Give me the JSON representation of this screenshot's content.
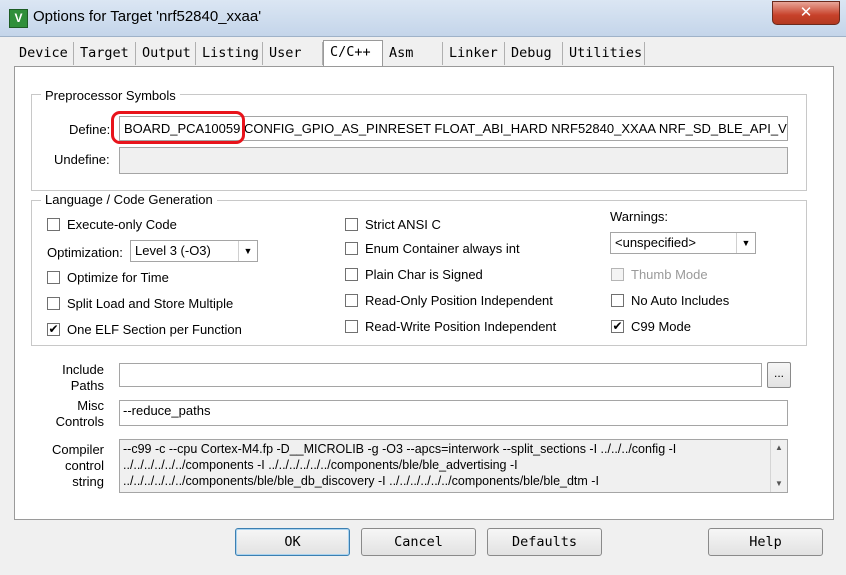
{
  "window": {
    "title": "Options for Target 'nrf52840_xxaa'",
    "app_icon": "keil-uvision-icon",
    "close_glyph": "✕"
  },
  "tabs": [
    {
      "label": "Device"
    },
    {
      "label": "Target"
    },
    {
      "label": "Output"
    },
    {
      "label": "Listing"
    },
    {
      "label": "User"
    },
    {
      "label": "C/C++",
      "active": true
    },
    {
      "label": "Asm"
    },
    {
      "label": "Linker"
    },
    {
      "label": "Debug"
    },
    {
      "label": "Utilities"
    }
  ],
  "preprocessor": {
    "legend": "Preprocessor Symbols",
    "define_label": "Define:",
    "define_value": "BOARD_PCA10059 CONFIG_GPIO_AS_PINRESET FLOAT_ABI_HARD NRF52840_XXAA NRF_SD_BLE_API_V",
    "undefine_label": "Undefine:",
    "undefine_value": ""
  },
  "language": {
    "legend": "Language / Code Generation",
    "execute_only": {
      "label": "Execute-only Code",
      "checked": false
    },
    "optimization_label": "Optimization:",
    "optimization_value": "Level 3 (-O3)",
    "optimize_time": {
      "label": "Optimize for Time",
      "checked": false
    },
    "split_load": {
      "label": "Split Load and Store Multiple",
      "checked": false
    },
    "one_elf": {
      "label": "One ELF Section per Function",
      "checked": true
    },
    "strict_ansi": {
      "label": "Strict ANSI C",
      "checked": false
    },
    "enum_container": {
      "label": "Enum Container always int",
      "checked": false
    },
    "plain_char": {
      "label": "Plain Char is Signed",
      "checked": false
    },
    "ropi": {
      "label": "Read-Only Position Independent",
      "checked": false
    },
    "rwpi": {
      "label": "Read-Write Position Independent",
      "checked": false
    },
    "warnings_label": "Warnings:",
    "warnings_value": "<unspecified>",
    "thumb_mode": {
      "label": "Thumb Mode",
      "checked": false,
      "disabled": true
    },
    "no_auto_includes": {
      "label": "No Auto Includes",
      "checked": false
    },
    "c99_mode": {
      "label": "C99 Mode",
      "checked": true
    },
    "check_glyph": "✔"
  },
  "include_paths": {
    "label_line1": "Include",
    "label_line2": "Paths",
    "value": "",
    "browse_label": "..."
  },
  "misc_controls": {
    "label_line1": "Misc",
    "label_line2": "Controls",
    "value": "--reduce_paths"
  },
  "compiler_string": {
    "label_line1": "Compiler",
    "label_line2": "control",
    "label_line3": "string",
    "lines": [
      "--c99 -c --cpu Cortex-M4.fp -D__MICROLIB -g -O3 --apcs=interwork --split_sections -I ../../../config -I",
      "../../../../../../components -I ../../../../../../components/ble/ble_advertising -I",
      "../../../../../../components/ble/ble_db_discovery -I ../../../../../../components/ble/ble_dtm -I"
    ]
  },
  "buttons": {
    "ok": "OK",
    "cancel": "Cancel",
    "defaults": "Defaults",
    "help": "Help"
  }
}
